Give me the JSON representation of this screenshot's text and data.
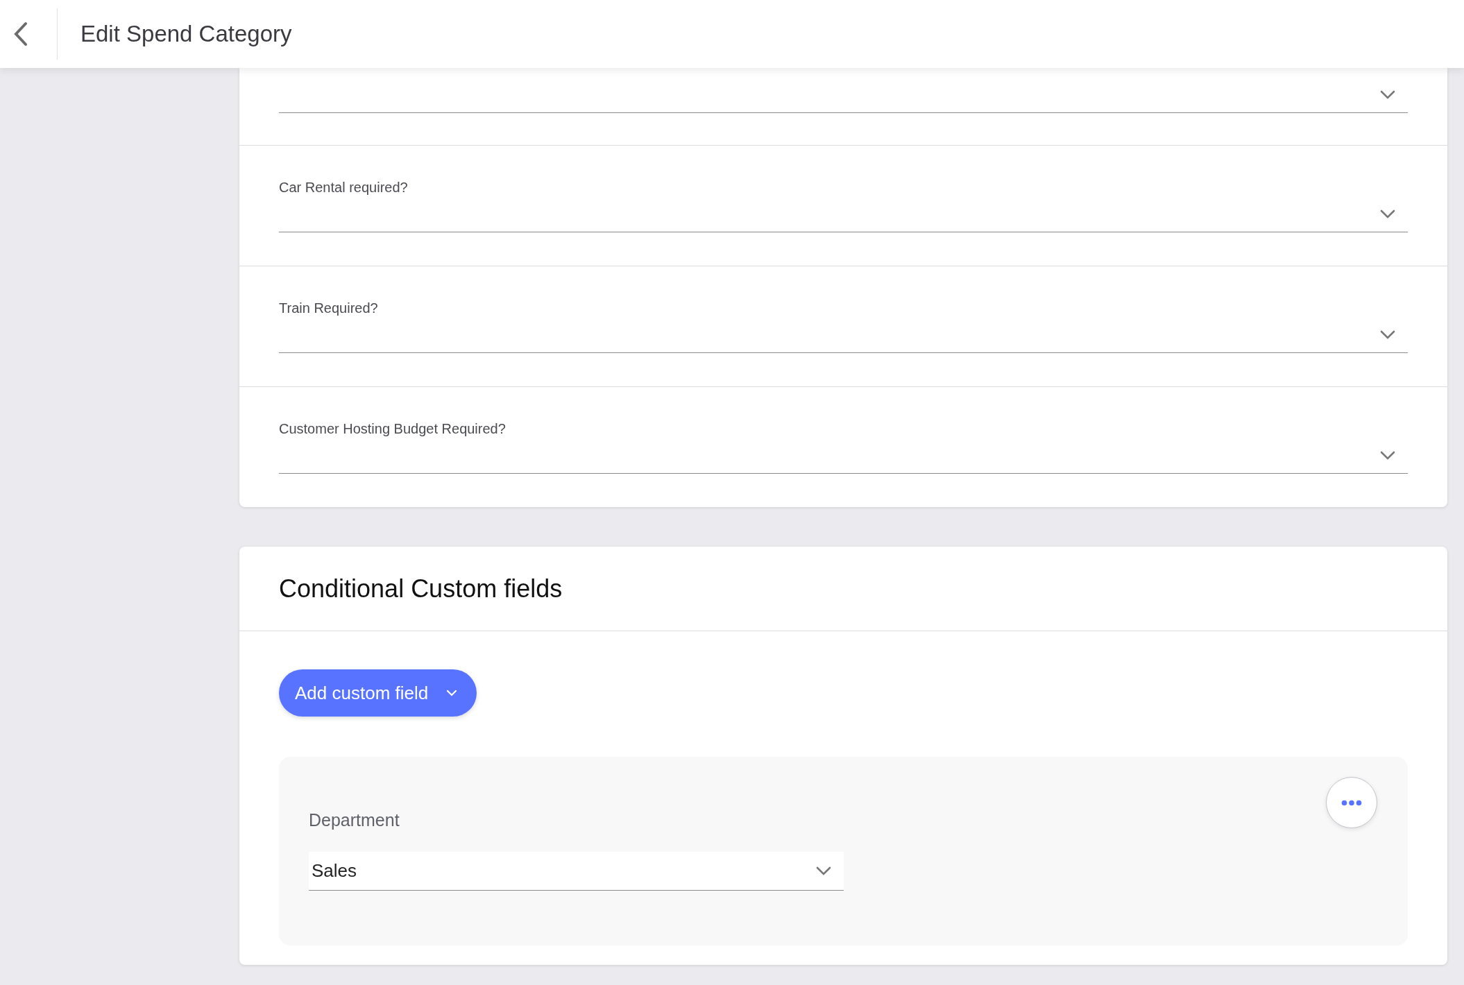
{
  "header": {
    "title": "Edit Spend Category"
  },
  "fields": [
    {
      "kind": "dropdown"
    },
    {
      "kind": "dropdown",
      "label": "Car Rental required?"
    },
    {
      "kind": "dropdown",
      "label": "Train Required?"
    },
    {
      "kind": "dropdown",
      "label": "Customer Hosting Budget Required?"
    }
  ],
  "conditional": {
    "title": "Conditional Custom fields",
    "add_button": "Add custom field",
    "custom_fields": [
      {
        "label": "Department",
        "value": "Sales"
      }
    ]
  }
}
